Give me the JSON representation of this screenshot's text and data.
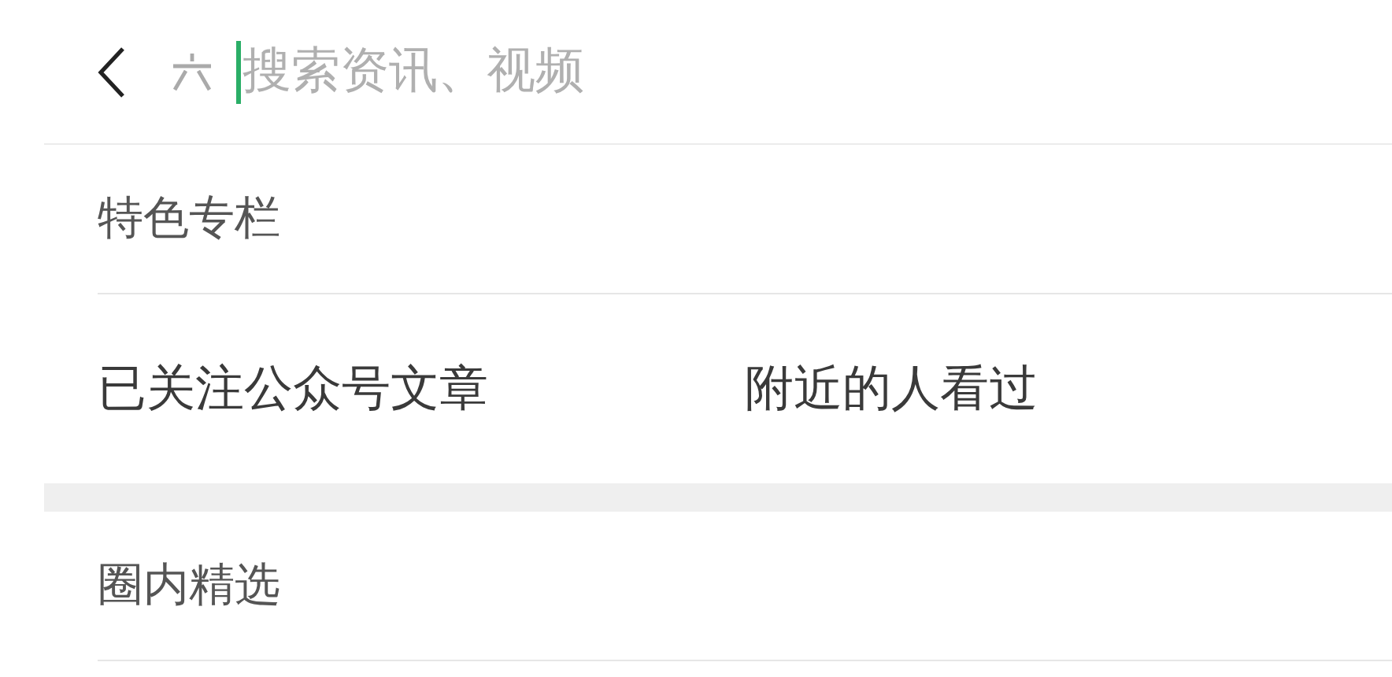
{
  "search": {
    "placeholder": "搜索资讯、视频"
  },
  "sections": [
    {
      "title": "特色专栏",
      "items": [
        "已关注公众号文章",
        "附近的人看过"
      ]
    },
    {
      "title": "圈内精选"
    }
  ]
}
